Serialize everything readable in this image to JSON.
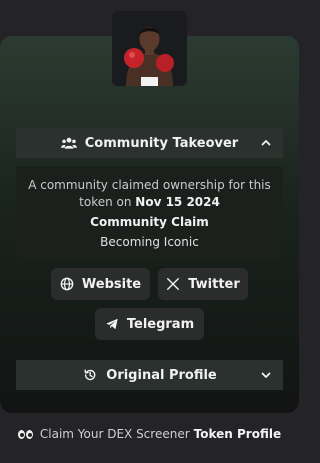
{
  "token": {
    "name": "iconic"
  },
  "community": {
    "header_label": "Community Takeover",
    "description_prefix": "A community claimed ownership for this token on",
    "claim_date": "Nov 15 2024",
    "claim_title": "Community Claim",
    "claim_subtitle": "Becoming Iconic"
  },
  "links": {
    "website": "Website",
    "twitter": "Twitter",
    "telegram": "Telegram"
  },
  "original_profile": {
    "label": "Original Profile"
  },
  "footer": {
    "prefix": "Claim Your DEX Screener",
    "highlight": "Token Profile"
  },
  "icons": {
    "users": "users-icon",
    "globe": "globe-icon",
    "x": "x-logo-icon",
    "telegram": "telegram-icon",
    "history": "history-icon",
    "eyes": "eyes-icon"
  }
}
